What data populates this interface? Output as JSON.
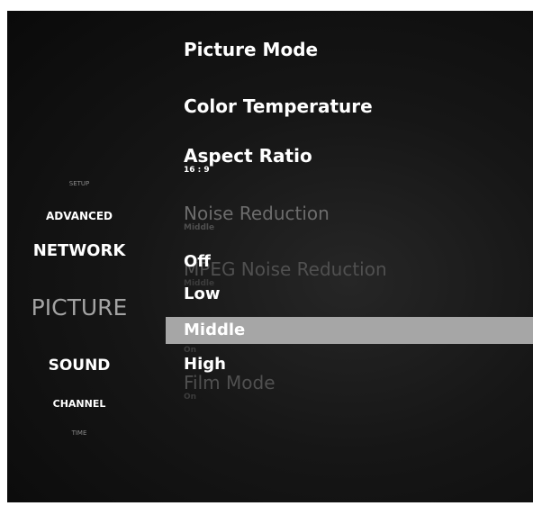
{
  "sidebar": {
    "items": [
      {
        "label": "SETUP"
      },
      {
        "label": "ADVANCED"
      },
      {
        "label": "NETWORK"
      },
      {
        "label": "PICTURE"
      },
      {
        "label": "SOUND"
      },
      {
        "label": "CHANNEL"
      },
      {
        "label": "TIME"
      }
    ],
    "selected": "PICTURE"
  },
  "menu": {
    "picture_mode": {
      "label": "Picture Mode"
    },
    "color_temperature": {
      "label": "Color Temperature"
    },
    "aspect_ratio": {
      "label": "Aspect Ratio",
      "value": "16 : 9"
    },
    "noise_reduction": {
      "label": "Noise Reduction",
      "value": "Middle"
    },
    "mpeg_noise_reduction": {
      "label": "MPEG Noise Reduction",
      "value": "Middle"
    },
    "hidden_setting": {
      "value": "On"
    },
    "film_mode": {
      "label": "Film Mode",
      "value": "On"
    }
  },
  "dropdown": {
    "options": [
      "Off",
      "Low",
      "Middle",
      "High"
    ],
    "selected": "Middle",
    "highlight_color": "#a6a6a6"
  }
}
